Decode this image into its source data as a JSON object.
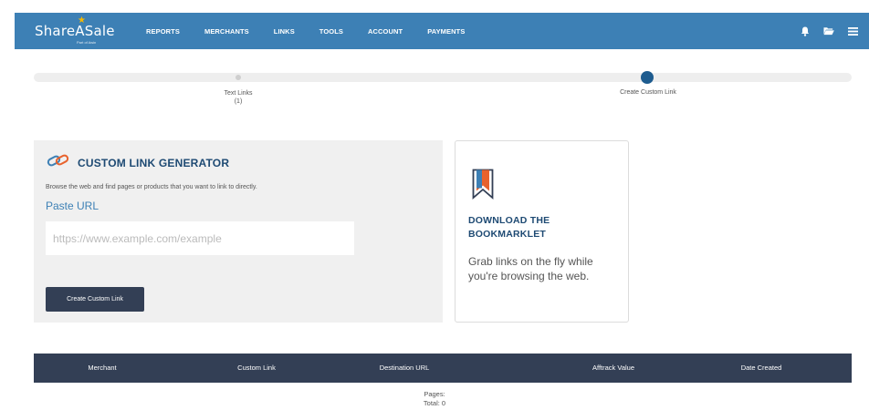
{
  "header": {
    "logo_text": "ShareASale",
    "logo_sub": "Part of Awin",
    "nav": [
      "REPORTS",
      "MERCHANTS",
      "LINKS",
      "TOOLS",
      "ACCOUNT",
      "PAYMENTS"
    ],
    "icons": [
      "bell-icon",
      "folder-icon",
      "menu-icon"
    ],
    "color": "#3d80b5"
  },
  "stepper": {
    "steps": [
      {
        "label": "Text Links",
        "sub": "(1)"
      },
      {
        "label": "Create Custom Link",
        "sub": ""
      }
    ],
    "active_color": "#1e5c8f"
  },
  "generator": {
    "title": "CUSTOM LINK GENERATOR",
    "description": "Browse the web and find pages or products that you want to link to directly.",
    "paste_label": "Paste URL",
    "url_placeholder": "https://www.example.com/example",
    "url_value": "",
    "button_label": "Create Custom Link"
  },
  "bookmarklet": {
    "title_line1": "DOWNLOAD THE",
    "title_line2": "BOOKMARKLET",
    "description": "Grab links on the fly while you're browsing the web."
  },
  "table": {
    "columns": [
      "Merchant",
      "Custom Link",
      "Destination URL",
      "Afftrack Value",
      "Date Created"
    ],
    "rows": []
  },
  "pagination": {
    "pages_label": "Pages:",
    "total_label": "Total: 0"
  }
}
